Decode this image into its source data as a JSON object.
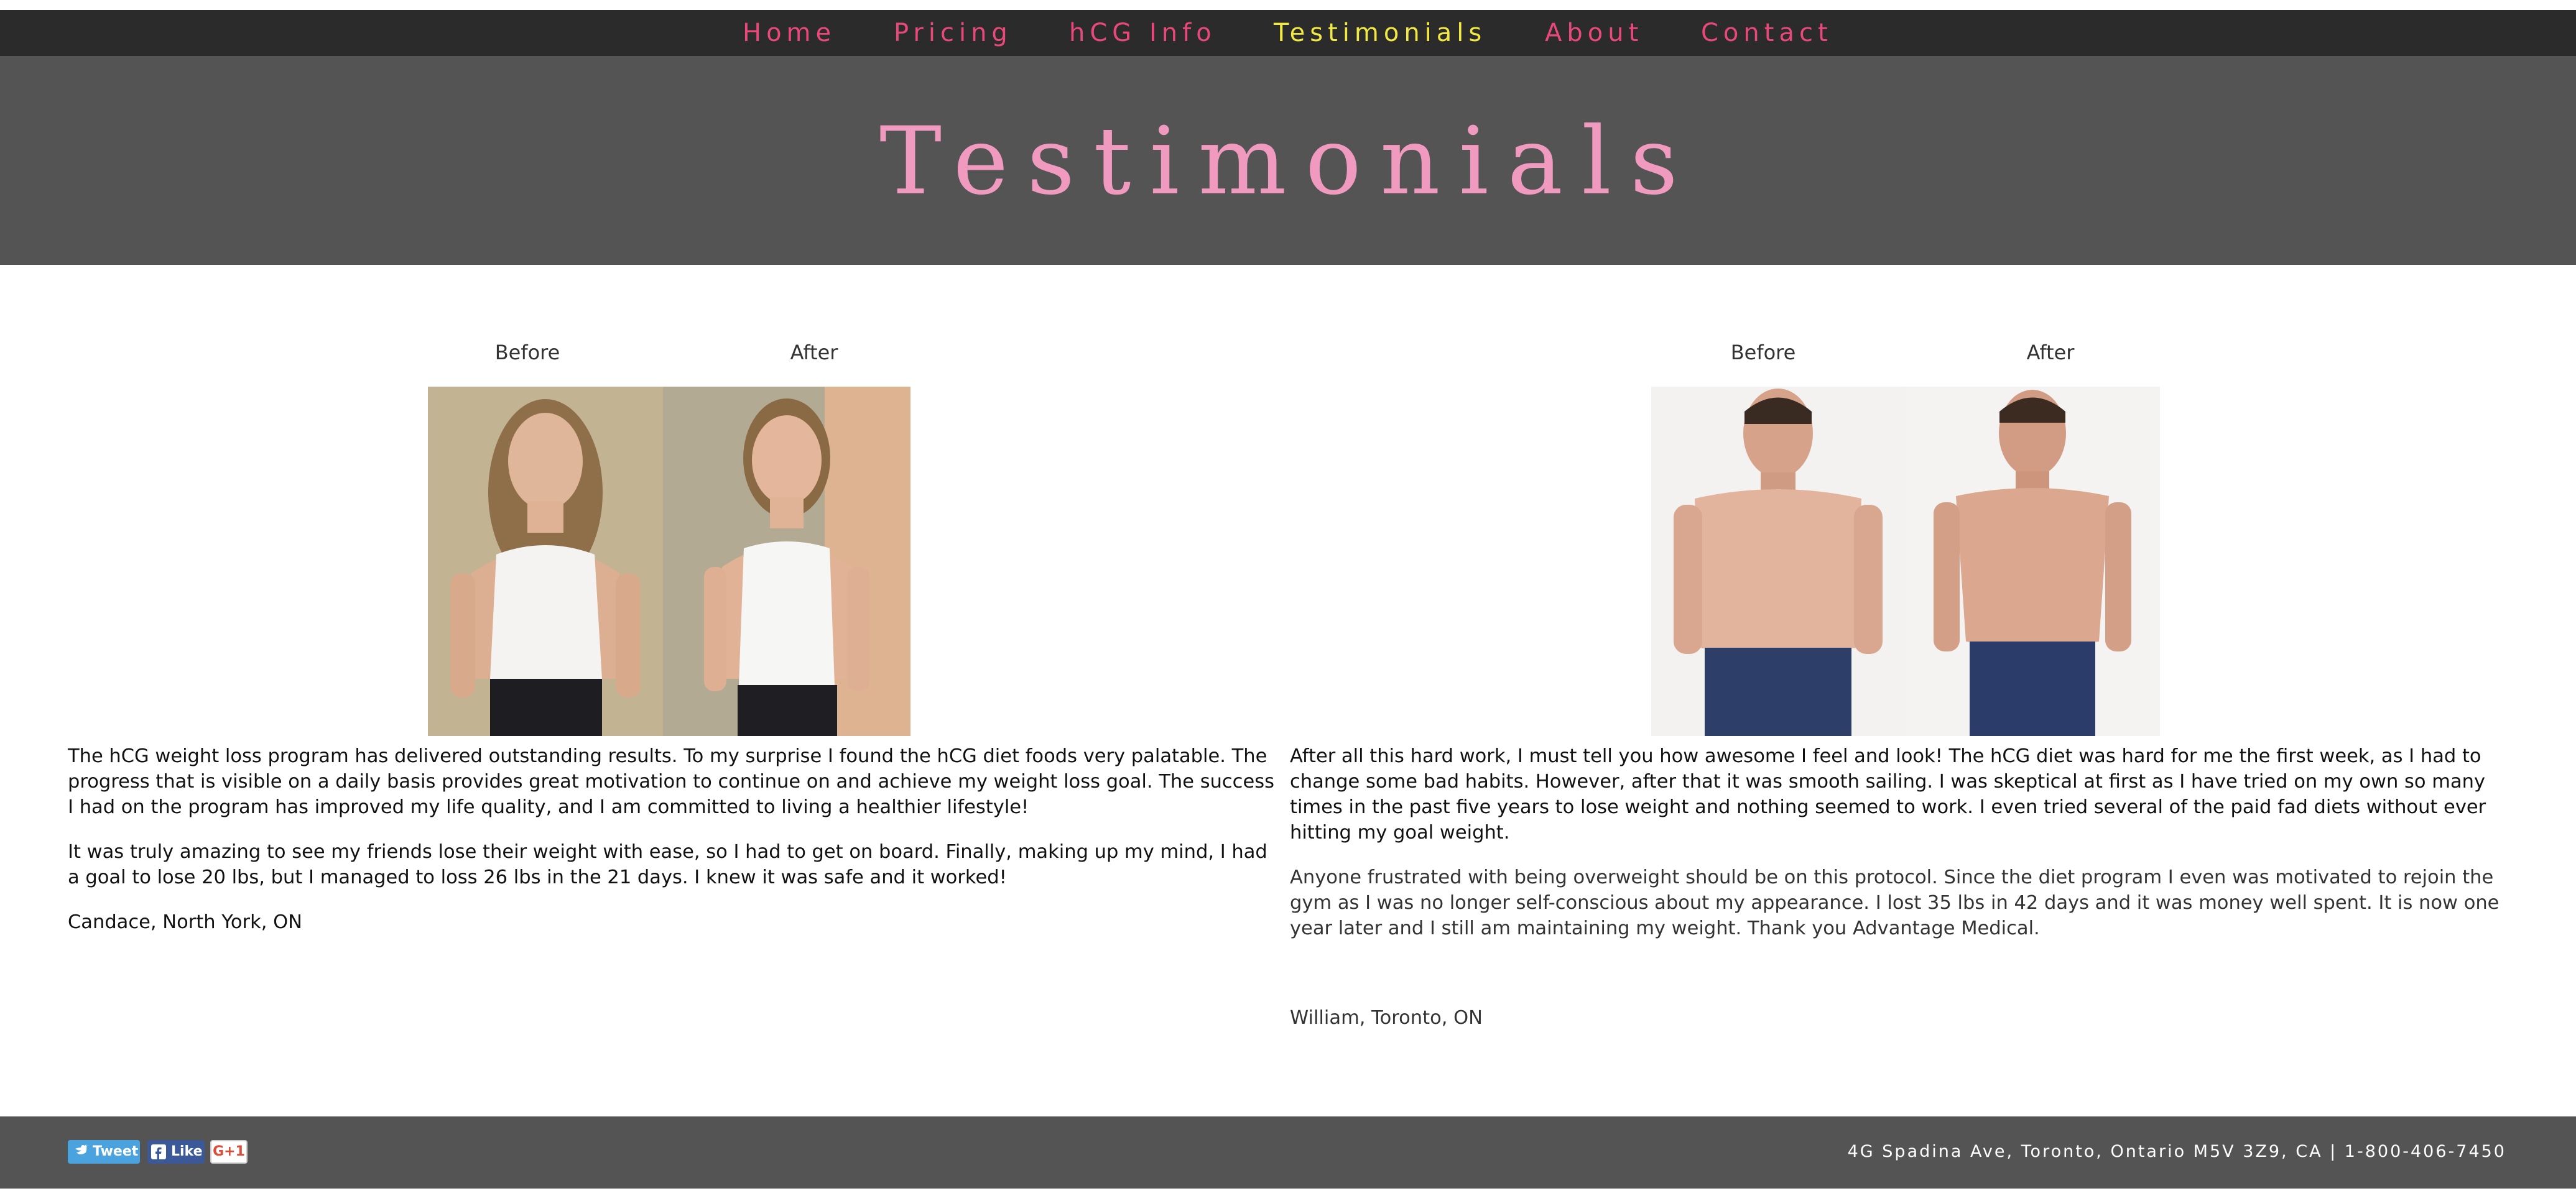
{
  "nav": {
    "items": [
      {
        "label": "Home",
        "active": false
      },
      {
        "label": "Pricing",
        "active": false
      },
      {
        "label": "hCG Info",
        "active": false
      },
      {
        "label": "Testimonials",
        "active": true
      },
      {
        "label": "About",
        "active": false
      },
      {
        "label": "Contact",
        "active": false
      }
    ]
  },
  "header": {
    "title": "Testimonials"
  },
  "testimonials": [
    {
      "before_label": "Before",
      "after_label": "After",
      "paragraphs": [
        "The hCG weight loss program has delivered outstanding results. To my surprise I found the hCG diet foods very palatable. The progress that is visible on a daily basis provides great motivation to continue on and achieve my weight loss goal. The success I had on the program has improved my life quality, and I am committed to living a healthier lifestyle!",
        "It was truly amazing to see my friends lose their weight with ease, so I had to get on board. Finally, making up my mind, I had a goal to lose 20 lbs, but I managed to loss 26 lbs in  the 21 days.  I knew it was safe and it worked!",
        "Candace, North York, ON"
      ]
    },
    {
      "before_label": "Before",
      "after_label": "After",
      "paragraphs": [
        "After all this hard work, I must tell you how awesome I feel and look! The hCG diet was hard for me the first week, as I had to change some bad habits. However, after that it was smooth sailing. I was skeptical at first as I have tried on my own so many times in the past five years to lose weight and nothing seemed to work.  I even tried several of the paid fad diets without ever hitting my goal weight.",
        "Anyone frustrated with being overweight should be on this protocol.  Since the diet program I even was motivated to rejoin the gym as I was no longer self-conscious about my appearance.  I lost 35 lbs in 42 days and it was money well spent.  It is now one year later and I still am maintaining my weight.  Thank you Advantage Medical.",
        "William, Toronto, ON"
      ]
    }
  ],
  "footer": {
    "tweet_label": "Tweet",
    "like_label": "Like",
    "gplus_label": "G+1",
    "address": "4G Spadina Ave, Toronto, Ontario M5V 3Z9, CA | 1-800-406-7450"
  },
  "colors": {
    "nav_link": "#e8487a",
    "nav_active": "#f1e843",
    "title": "#f19ac0",
    "header_bg": "#545454",
    "nav_bg": "#2b2b2b"
  }
}
